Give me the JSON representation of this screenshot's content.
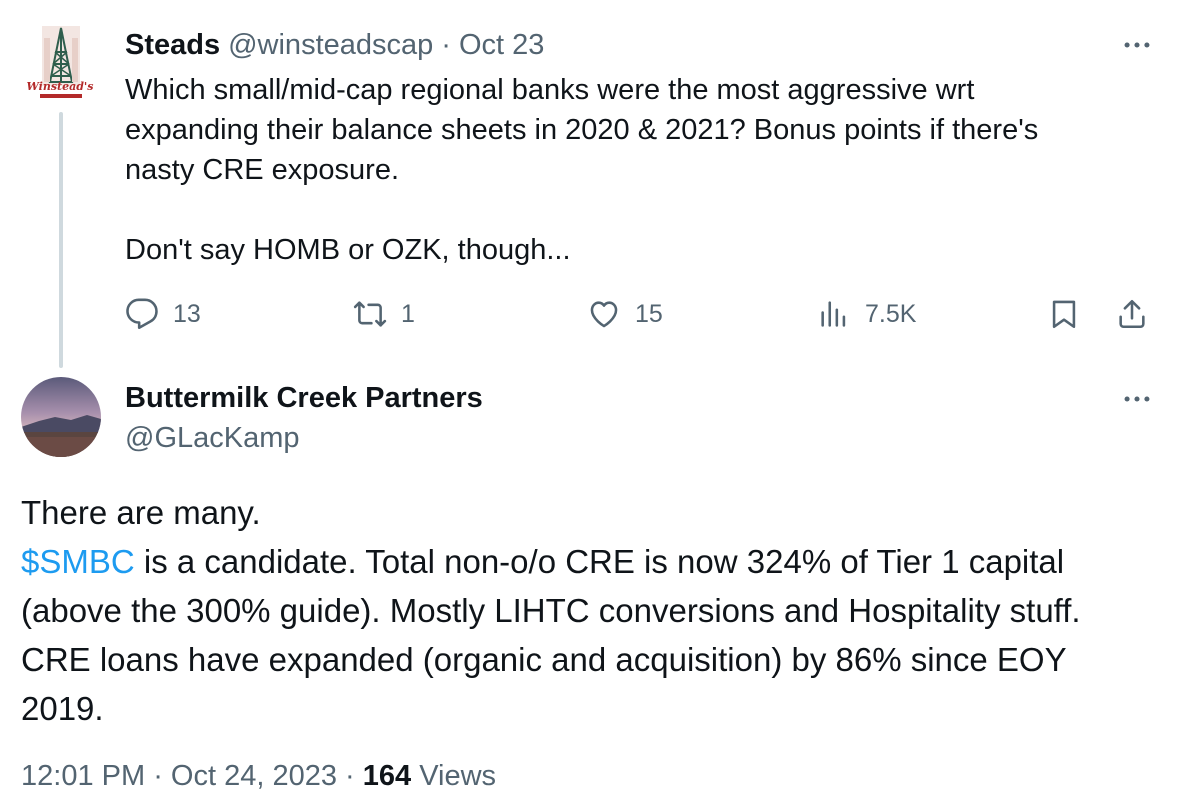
{
  "parent_tweet": {
    "author_name": "Steads",
    "handle": "@winsteadscap",
    "separator": "·",
    "date": "Oct 23",
    "logo_text": "Winstead's",
    "text_lines": [
      "Which small/mid-cap regional banks were the most aggressive wrt",
      "expanding their balance sheets in 2020 & 2021? Bonus points if there's",
      "nasty CRE exposure."
    ],
    "text_line_2": "Don't say HOMB or OZK, though...",
    "replies": "13",
    "retweets": "1",
    "likes": "15",
    "views": "7.5K",
    "icons": [
      "more-icon",
      "reply-icon",
      "retweet-icon",
      "like-icon",
      "views-icon",
      "bookmark-icon",
      "share-icon"
    ]
  },
  "reply_tweet": {
    "author_name": "Buttermilk Creek Partners",
    "handle": "@GLacKamp",
    "line1": "There are many.",
    "cashtag": "$SMBC",
    "line2_rest": " is a candidate. Total non-o/o CRE is now 324% of Tier 1 capital",
    "line3": "(above the 300% guide). Mostly LIHTC conversions and Hospitality stuff.",
    "line4": "CRE loans have expanded (organic and acquisition) by 86% since EOY",
    "line5": "2019.",
    "time": "12:01 PM",
    "separator": "·",
    "date": "Oct 24, 2023",
    "view_count": "164",
    "views_label": " Views"
  },
  "colors": {
    "text": "#0f1419",
    "secondary": "#536471",
    "link": "#1d9bf0",
    "thread_line": "#cfd9de",
    "logo_red": "#b32a2a"
  }
}
